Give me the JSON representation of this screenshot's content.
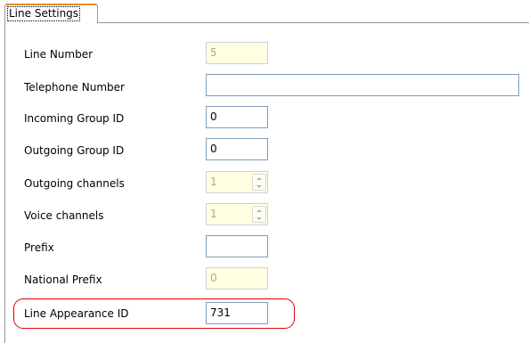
{
  "tab": {
    "label": "Line Settings"
  },
  "fields": {
    "line_number": {
      "label": "Line Number",
      "value": "5"
    },
    "telephone_number": {
      "label": "Telephone Number",
      "value": ""
    },
    "incoming_group_id": {
      "label": "Incoming Group ID",
      "value": "0"
    },
    "outgoing_group_id": {
      "label": "Outgoing Group ID",
      "value": "0"
    },
    "outgoing_channels": {
      "label": "Outgoing channels",
      "value": "1"
    },
    "voice_channels": {
      "label": "Voice channels",
      "value": "1"
    },
    "prefix": {
      "label": "Prefix",
      "value": ""
    },
    "national_prefix": {
      "label": "National Prefix",
      "value": "0"
    },
    "line_appearance_id": {
      "label": "Line Appearance ID",
      "value": "731"
    }
  },
  "colors": {
    "disabled_field_bg": "#ffffe1",
    "field_border": "#7f9db9",
    "highlight_outline": "#e30000",
    "tab_accent": "#e68b2c"
  }
}
